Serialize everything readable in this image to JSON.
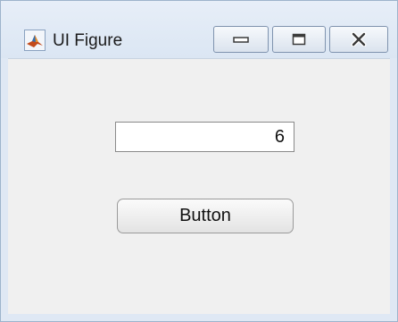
{
  "window": {
    "title": "UI Figure",
    "app_icon": "matlab-membrane-icon",
    "controls": {
      "minimize_icon": "minimize-icon",
      "maximize_icon": "maximize-icon",
      "close_icon": "close-icon"
    }
  },
  "content": {
    "numeric_field_value": "6",
    "button_label": "Button"
  }
}
